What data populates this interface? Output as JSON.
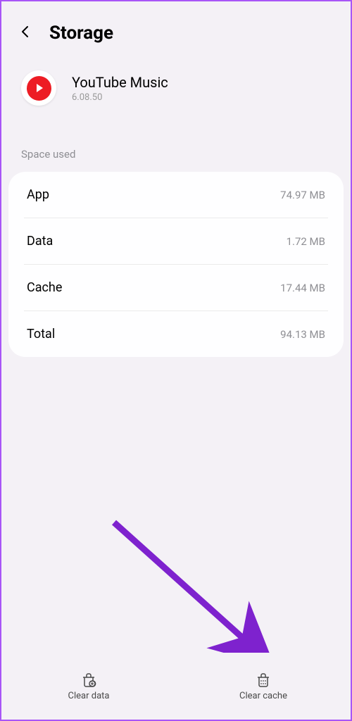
{
  "header": {
    "title": "Storage"
  },
  "app": {
    "name": "YouTube Music",
    "version": "6.08.50"
  },
  "section": {
    "label": "Space used"
  },
  "rows": [
    {
      "label": "App",
      "value": "74.97 MB"
    },
    {
      "label": "Data",
      "value": "1.72 MB"
    },
    {
      "label": "Cache",
      "value": "17.44 MB"
    },
    {
      "label": "Total",
      "value": "94.13 MB"
    }
  ],
  "actions": {
    "clear_data": "Clear data",
    "clear_cache": "Clear cache"
  }
}
